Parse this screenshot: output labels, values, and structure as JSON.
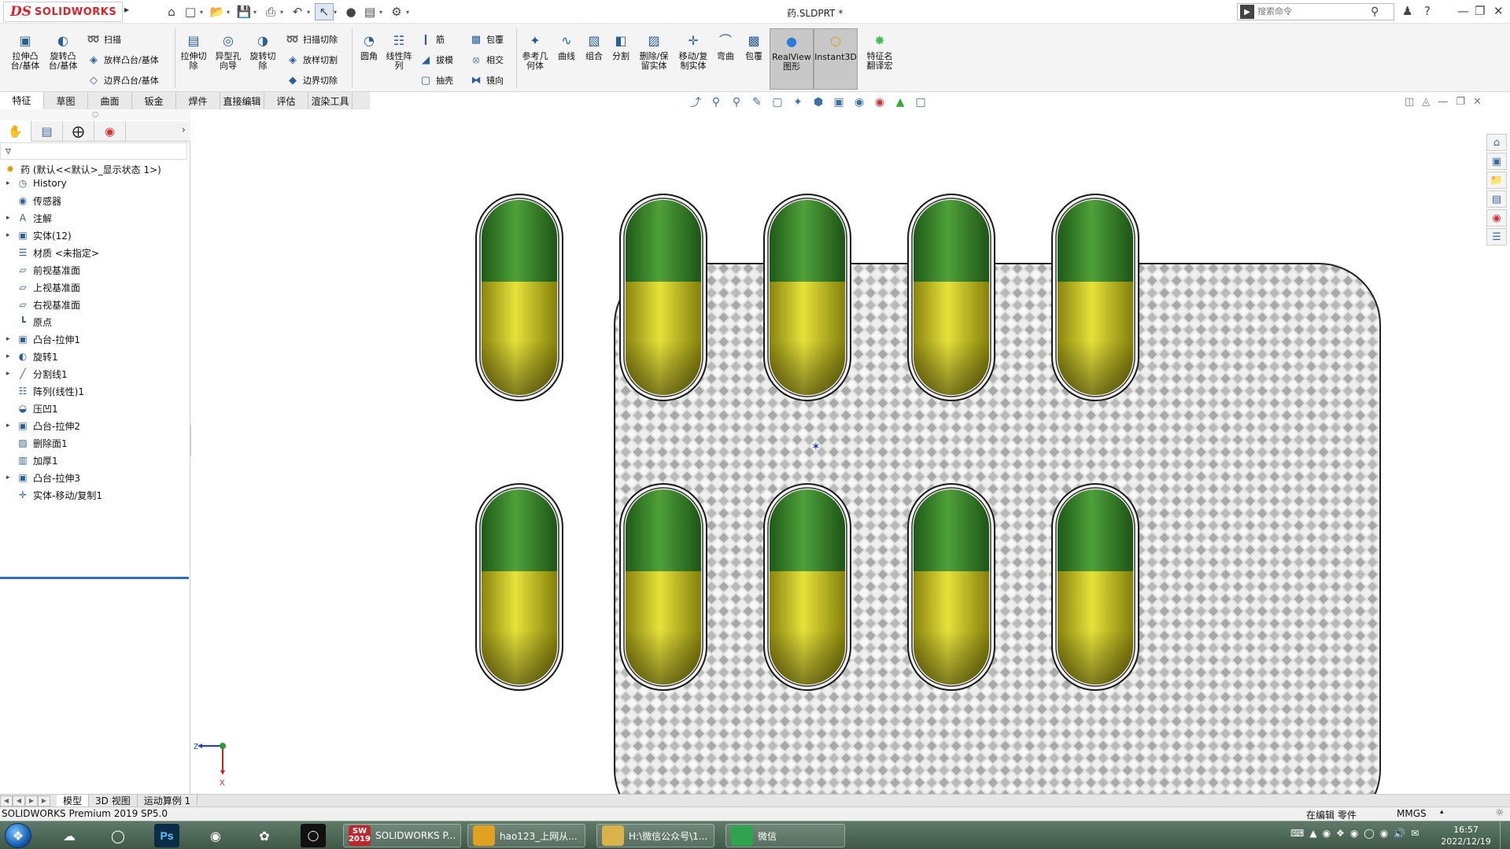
{
  "app": {
    "logo_ds": "DS",
    "logo_brand": "SOLIDWORKS",
    "doc_title": "药.SLDPRT *",
    "search_placeholder": "搜索命令"
  },
  "ribbon": {
    "left_group": [
      {
        "label": "拉伸凸\n台/基体",
        "icon": "extrude-boss-icon"
      },
      {
        "label": "旋转凸\n台/基体",
        "icon": "revolve-boss-icon"
      }
    ],
    "left_small": [
      {
        "label": "扫描",
        "icon": "sweep-icon"
      },
      {
        "label": "放样凸台/基体",
        "icon": "loft-icon"
      },
      {
        "label": "边界凸台/基体",
        "icon": "boundary-icon"
      }
    ],
    "cut_group": [
      {
        "label": "拉伸切\n除",
        "icon": "extrude-cut-icon"
      },
      {
        "label": "异型孔\n向导",
        "icon": "hole-wizard-icon"
      },
      {
        "label": "旋转切\n除",
        "icon": "revolve-cut-icon"
      }
    ],
    "cut_small": [
      {
        "label": "扫描切除",
        "icon": "swept-cut-icon"
      },
      {
        "label": "放样切割",
        "icon": "lofted-cut-icon"
      },
      {
        "label": "边界切除",
        "icon": "boundary-cut-icon"
      }
    ],
    "feat_group": [
      {
        "label": "圆角",
        "icon": "fillet-icon"
      },
      {
        "label": "线性阵\n列",
        "icon": "linear-pattern-icon"
      }
    ],
    "feat_small": [
      {
        "label": "筋",
        "icon": "rib-icon"
      },
      {
        "label": "拔模",
        "icon": "draft-icon"
      },
      {
        "label": "抽壳",
        "icon": "shell-icon"
      },
      {
        "label": "包覆",
        "icon": "wrap-icon"
      },
      {
        "label": "相交",
        "icon": "intersect-icon"
      },
      {
        "label": "镜向",
        "icon": "mirror-icon"
      }
    ],
    "right_group": [
      {
        "label": "参考几\n何体",
        "icon": "reference-geometry-icon"
      },
      {
        "label": "曲线",
        "icon": "curves-icon"
      },
      {
        "label": "组合",
        "icon": "combine-icon"
      },
      {
        "label": "分割",
        "icon": "split-icon"
      },
      {
        "label": "删除/保\n留实体",
        "icon": "delete-body-icon"
      },
      {
        "label": "移动/复\n制实体",
        "icon": "move-copy-icon"
      },
      {
        "label": "弯曲",
        "icon": "flex-icon"
      },
      {
        "label": "包覆",
        "icon": "wrap-icon"
      },
      {
        "label": "RealView\n图形",
        "icon": "realview-icon"
      },
      {
        "label": "Instant3D",
        "icon": "instant3d-icon"
      },
      {
        "label": "特征名\n翻译宏",
        "icon": "macro-icon"
      }
    ]
  },
  "tabs": [
    "特征",
    "草图",
    "曲面",
    "钣金",
    "焊件",
    "直接编辑",
    "评估",
    "渲染工具"
  ],
  "tree": {
    "root": "药 (默认<<默认>_显示状态 1>)",
    "items": [
      {
        "label": "History",
        "expand": true,
        "icon": "history-icon"
      },
      {
        "label": "传感器",
        "expand": false,
        "icon": "sensor-icon"
      },
      {
        "label": "注解",
        "expand": true,
        "icon": "annotation-icon"
      },
      {
        "label": "实体(12)",
        "expand": true,
        "icon": "solid-bodies-icon"
      },
      {
        "label": "材质 <未指定>",
        "expand": false,
        "icon": "material-icon"
      },
      {
        "label": "前视基准面",
        "expand": false,
        "icon": "plane-icon"
      },
      {
        "label": "上视基准面",
        "expand": false,
        "icon": "plane-icon"
      },
      {
        "label": "右视基准面",
        "expand": false,
        "icon": "plane-icon"
      },
      {
        "label": "原点",
        "expand": false,
        "icon": "origin-icon"
      },
      {
        "label": "凸台-拉伸1",
        "expand": true,
        "icon": "extrude-boss-icon"
      },
      {
        "label": "旋转1",
        "expand": true,
        "icon": "revolve-boss-icon"
      },
      {
        "label": "分割线1",
        "expand": true,
        "icon": "split-line-icon"
      },
      {
        "label": "阵列(线性)1",
        "expand": false,
        "icon": "linear-pattern-icon"
      },
      {
        "label": "压凹1",
        "expand": false,
        "icon": "indent-icon"
      },
      {
        "label": "凸台-拉伸2",
        "expand": true,
        "icon": "extrude-boss-icon"
      },
      {
        "label": "删除面1",
        "expand": false,
        "icon": "delete-face-icon"
      },
      {
        "label": "加厚1",
        "expand": false,
        "icon": "thicken-icon"
      },
      {
        "label": "凸台-拉伸3",
        "expand": true,
        "icon": "extrude-boss-icon"
      },
      {
        "label": "实体-移动/复制1",
        "expand": false,
        "icon": "move-copy-icon"
      }
    ]
  },
  "bottom_tabs": [
    "模型",
    "3D 视图",
    "运动算例 1"
  ],
  "status": {
    "product": "SOLIDWORKS Premium 2019 SP5.0",
    "mode": "在编辑 零件",
    "units": "MMGS"
  },
  "triad": {
    "z": "Z",
    "x": "X"
  },
  "taskbar": {
    "windows": [
      {
        "label": "SOLIDWORKS P...",
        "badge": "SW\n2019"
      },
      {
        "label": "hao123_上网从...",
        "badge": ""
      },
      {
        "label": "H:\\微信公众号\\1...",
        "badge": ""
      },
      {
        "label": "微信",
        "badge": ""
      }
    ],
    "time": "16:57",
    "date": "2022/12/19"
  },
  "colors": {
    "capsule_top": "#3a8a2a",
    "capsule_bottom": "#d6d12a",
    "blister_bg": "#d9d9d9",
    "accent": "#2f6fb8"
  },
  "model": {
    "rows": 2,
    "cols": 5
  }
}
